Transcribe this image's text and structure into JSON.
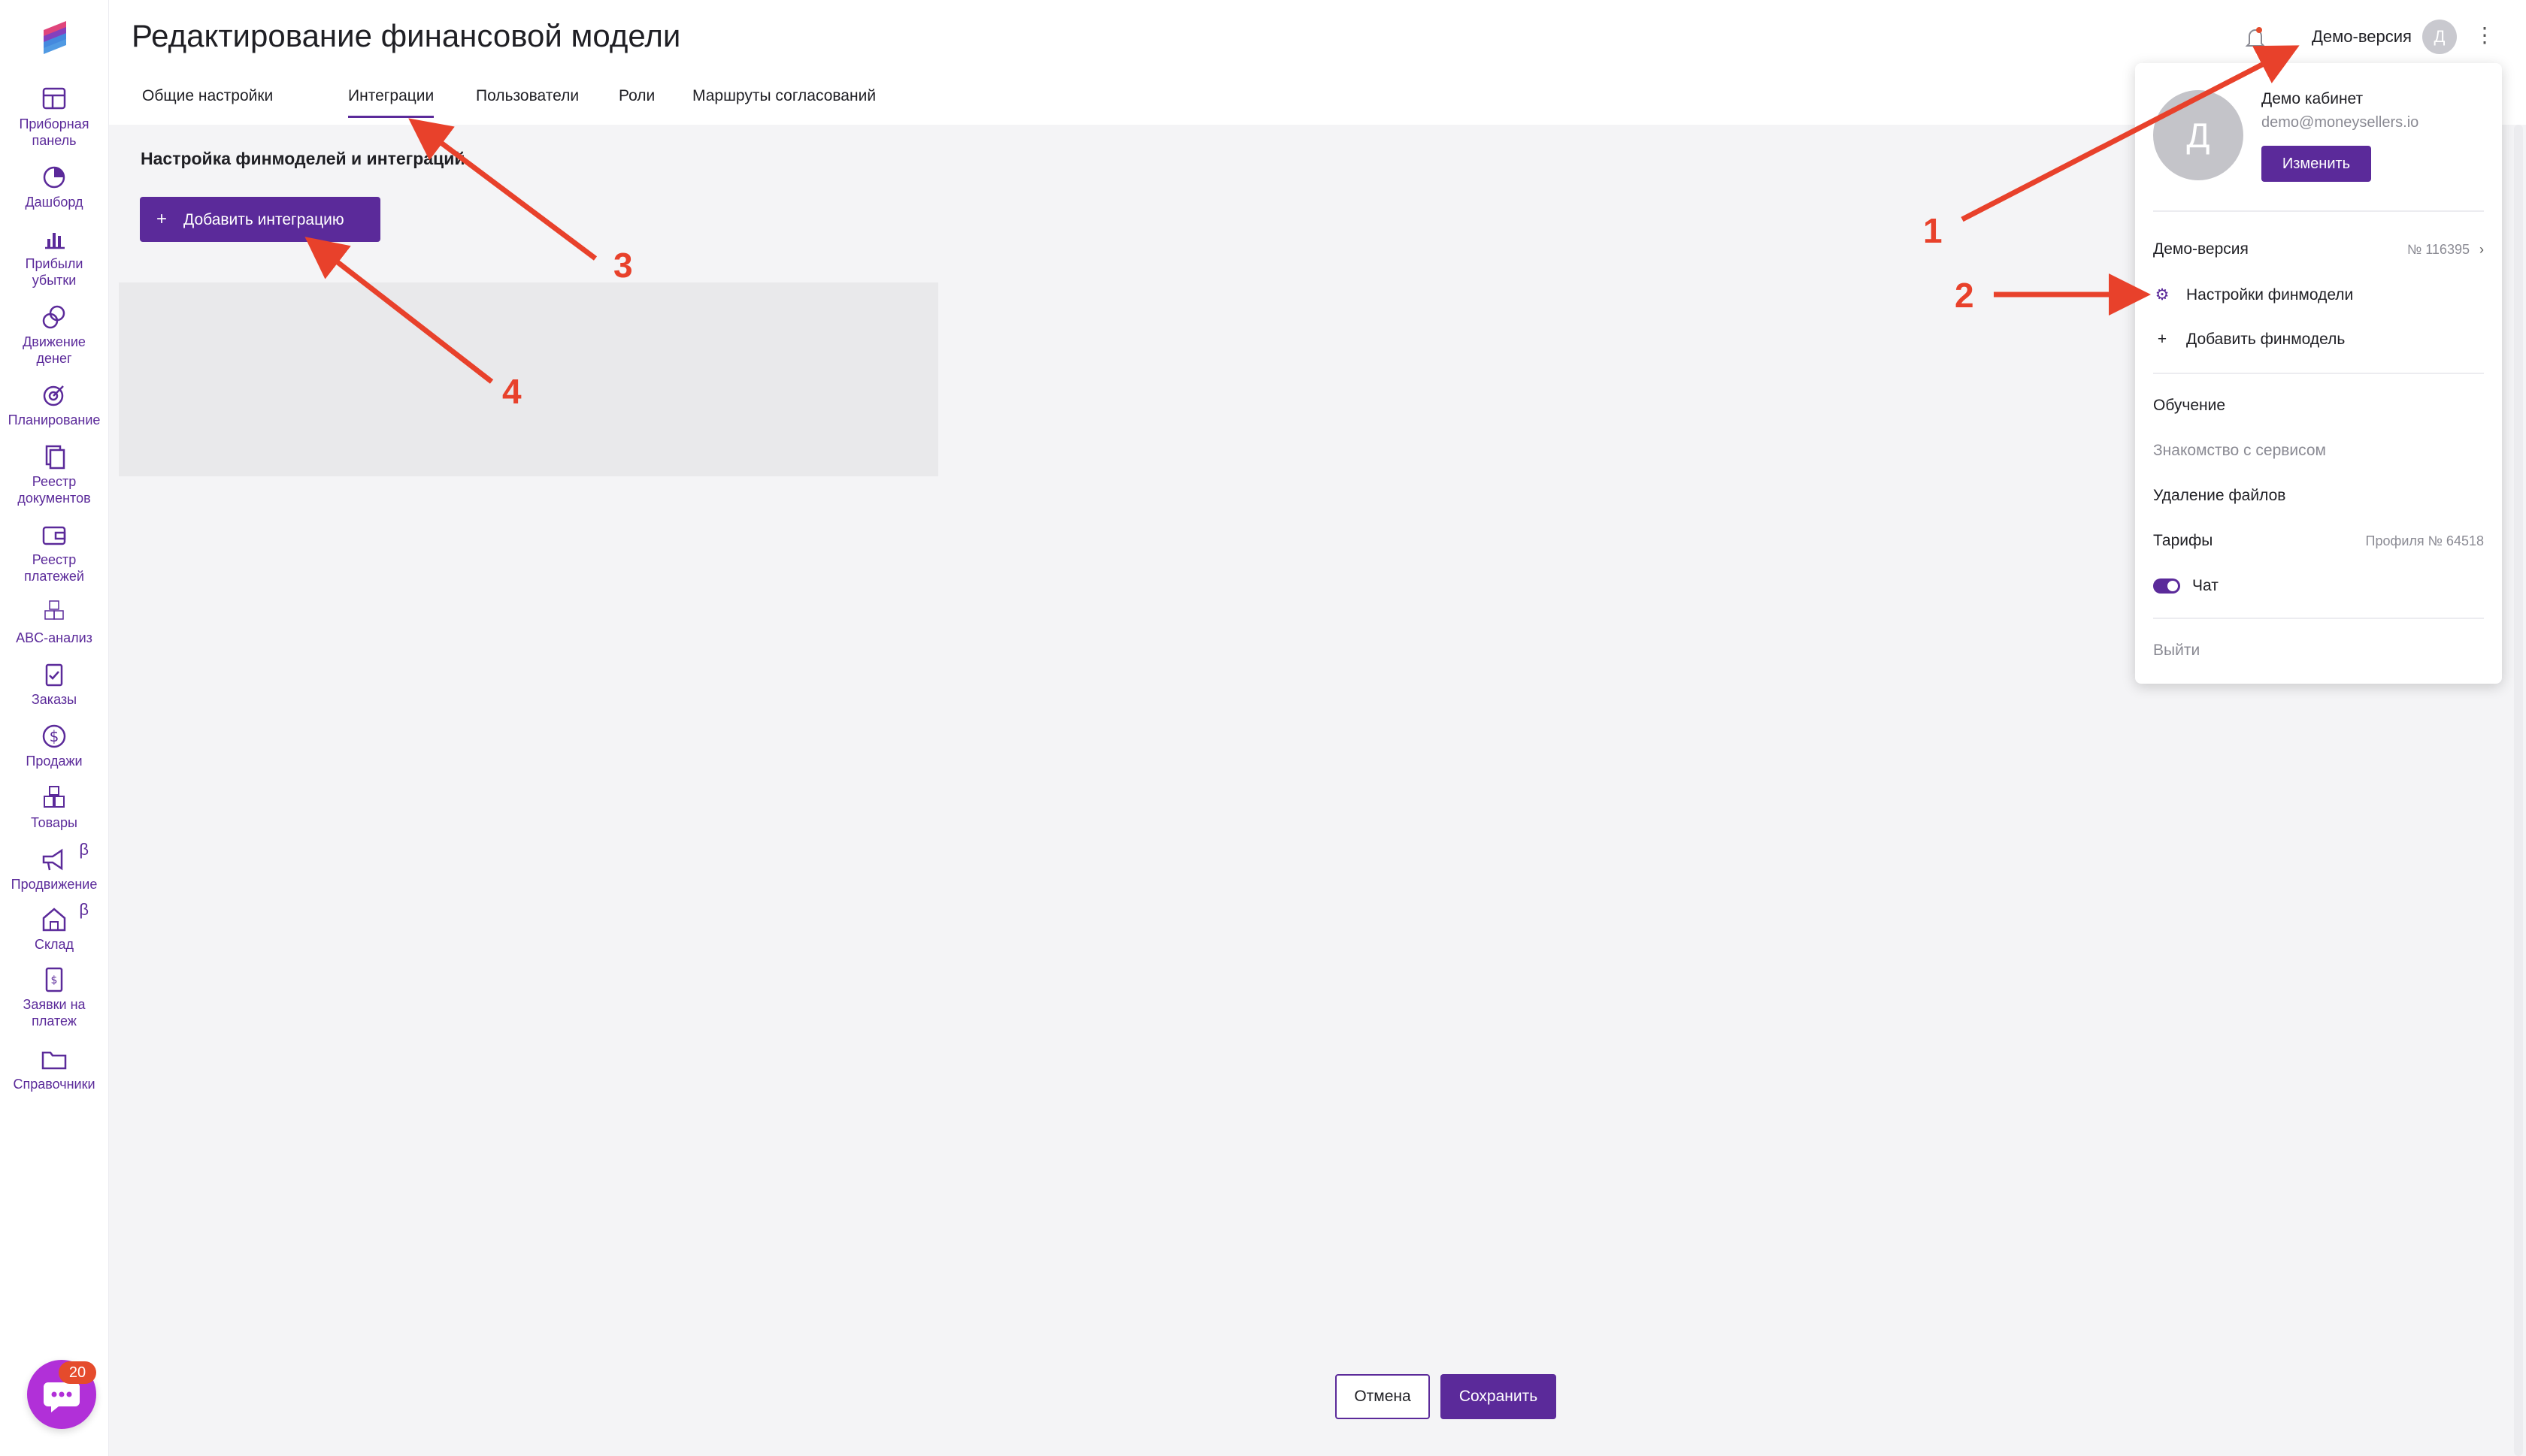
{
  "header": {
    "title": "Редактирование финансовой модели",
    "account_label": "Демо-версия",
    "avatar_letter": "Д"
  },
  "tabs": [
    {
      "label": "Общие настройки"
    },
    {
      "label": "Интеграции"
    },
    {
      "label": "Пользователи"
    },
    {
      "label": "Роли"
    },
    {
      "label": "Маршруты согласований"
    }
  ],
  "active_tab": "Интеграции",
  "sidebar": {
    "items": [
      {
        "label1": "Приборная",
        "label2": "панель",
        "icon": "dashboard-icon"
      },
      {
        "label1": "Дашборд",
        "label2": "",
        "icon": "pie-chart-icon"
      },
      {
        "label1": "Прибыли",
        "label2": "убытки",
        "icon": "bar-chart-icon"
      },
      {
        "label1": "Движение",
        "label2": "денег",
        "icon": "coins-icon"
      },
      {
        "label1": "Планирование",
        "label2": "",
        "icon": "target-icon"
      },
      {
        "label1": "Реестр",
        "label2": "документов",
        "icon": "documents-icon"
      },
      {
        "label1": "Реестр",
        "label2": "платежей",
        "icon": "wallet-icon"
      },
      {
        "label1": "ABC-анализ",
        "label2": "",
        "icon": "abc-icon"
      },
      {
        "label1": "Заказы",
        "label2": "",
        "icon": "clipboard-icon"
      },
      {
        "label1": "Продажи",
        "label2": "",
        "icon": "dollar-icon"
      },
      {
        "label1": "Товары",
        "label2": "",
        "icon": "boxes-icon"
      },
      {
        "label1": "Продвижение",
        "label2": "",
        "icon": "megaphone-icon",
        "beta": "β"
      },
      {
        "label1": "Склад",
        "label2": "",
        "icon": "warehouse-icon",
        "beta": "β"
      },
      {
        "label1": "Заявки на",
        "label2": "платеж",
        "icon": "invoice-icon"
      },
      {
        "label1": "Справочники",
        "label2": "",
        "icon": "folder-icon"
      }
    ]
  },
  "main": {
    "section_title": "Настройка финмоделей и интеграций",
    "add_button_label": "Добавить интеграцию"
  },
  "footer": {
    "cancel_label": "Отмена",
    "save_label": "Сохранить"
  },
  "chat": {
    "badge_count": "20"
  },
  "dropdown": {
    "avatar_letter": "Д",
    "name": "Демо кабинет",
    "email": "demo@moneysellers.io",
    "change_label": "Изменить",
    "demo_label": "Демо-версия",
    "demo_number": "№ 116395",
    "settings_label": "Настройки финмодели",
    "add_model_label": "Добавить финмодель",
    "training_label": "Обучение",
    "intro_label": "Знакомство с сервисом",
    "delete_files_label": "Удаление файлов",
    "tariffs_label": "Тарифы",
    "profile_label": "Профиля № 64518",
    "chat_label": "Чат",
    "logout_label": "Выйти"
  },
  "annotations": {
    "n1": "1",
    "n2": "2",
    "n3": "3",
    "n4": "4",
    "color": "#e8412b"
  },
  "colors": {
    "accent": "#5b2a9a",
    "chat": "#b130d8",
    "badge": "#e54b2c"
  }
}
